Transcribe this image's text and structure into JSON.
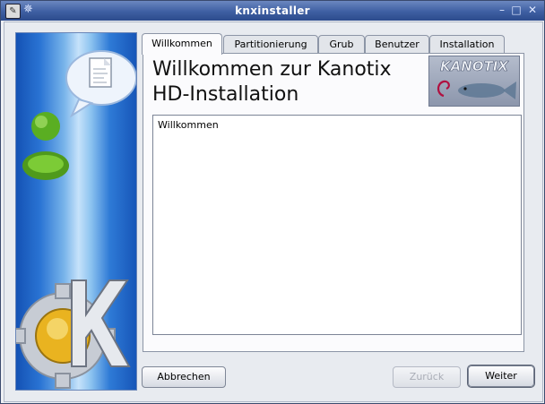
{
  "window": {
    "title": "knxinstaller",
    "app_icon": "installer-app-icon",
    "pin_glyph": "✵",
    "controls": {
      "minimize": "–",
      "maximize": "□",
      "close": "✕"
    }
  },
  "tabs": [
    {
      "label": "Willkommen",
      "active": true
    },
    {
      "label": "Partitionierung",
      "active": false
    },
    {
      "label": "Grub",
      "active": false
    },
    {
      "label": "Benutzer",
      "active": false
    },
    {
      "label": "Installation",
      "active": false
    }
  ],
  "welcome": {
    "heading_line1": "Willkommen zur Kanotix",
    "heading_line2": "HD-Installation",
    "logo_text": "KANOTIX",
    "body_text": "Willkommen"
  },
  "buttons": {
    "cancel": "Abbrechen",
    "back": "Zurück",
    "next": "Weiter"
  },
  "sidebar": {
    "icons": [
      "document-speech-bubble-icon",
      "user-icon",
      "kde-gear-logo-icon"
    ],
    "kde_letter": "K"
  }
}
